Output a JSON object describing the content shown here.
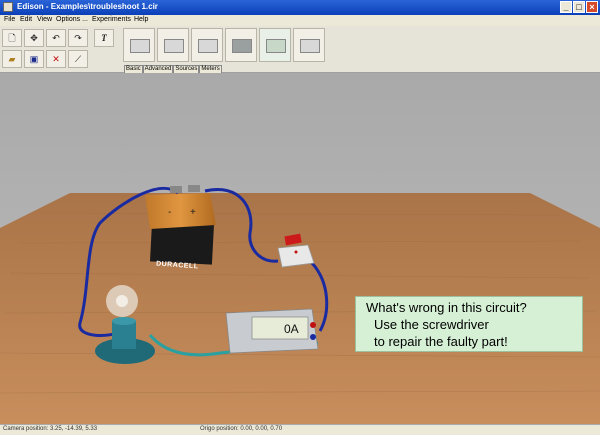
{
  "window": {
    "title": "Edison - Examples\\troubleshoot 1.cir"
  },
  "menu": [
    "File",
    "Edit",
    "View",
    "Options ...",
    "Experiments",
    "Help"
  ],
  "toolbar": {
    "buttons": [
      "new-icon",
      "move-icon",
      "undo-icon",
      "redo-icon",
      "text-icon",
      "open-icon",
      "save-icon",
      "delete-icon",
      "screwdriver-icon"
    ],
    "text_tool_label": "T"
  },
  "tabs": [
    "Basic",
    "Advanced",
    "Sources",
    "Meters"
  ],
  "scene": {
    "battery_brand": "DURACELL",
    "battery_minus": "-",
    "battery_plus": "+",
    "meter_reading": "0A",
    "callout": {
      "line1": "What's wrong in this circuit?",
      "line2": "Use the screwdriver",
      "line3": "to repair the faulty part!"
    }
  },
  "status": {
    "camera": "Camera position: 3.25, -14.39, 5.33",
    "origin": "Origo position: 0.00, 0.00, 0.70"
  }
}
